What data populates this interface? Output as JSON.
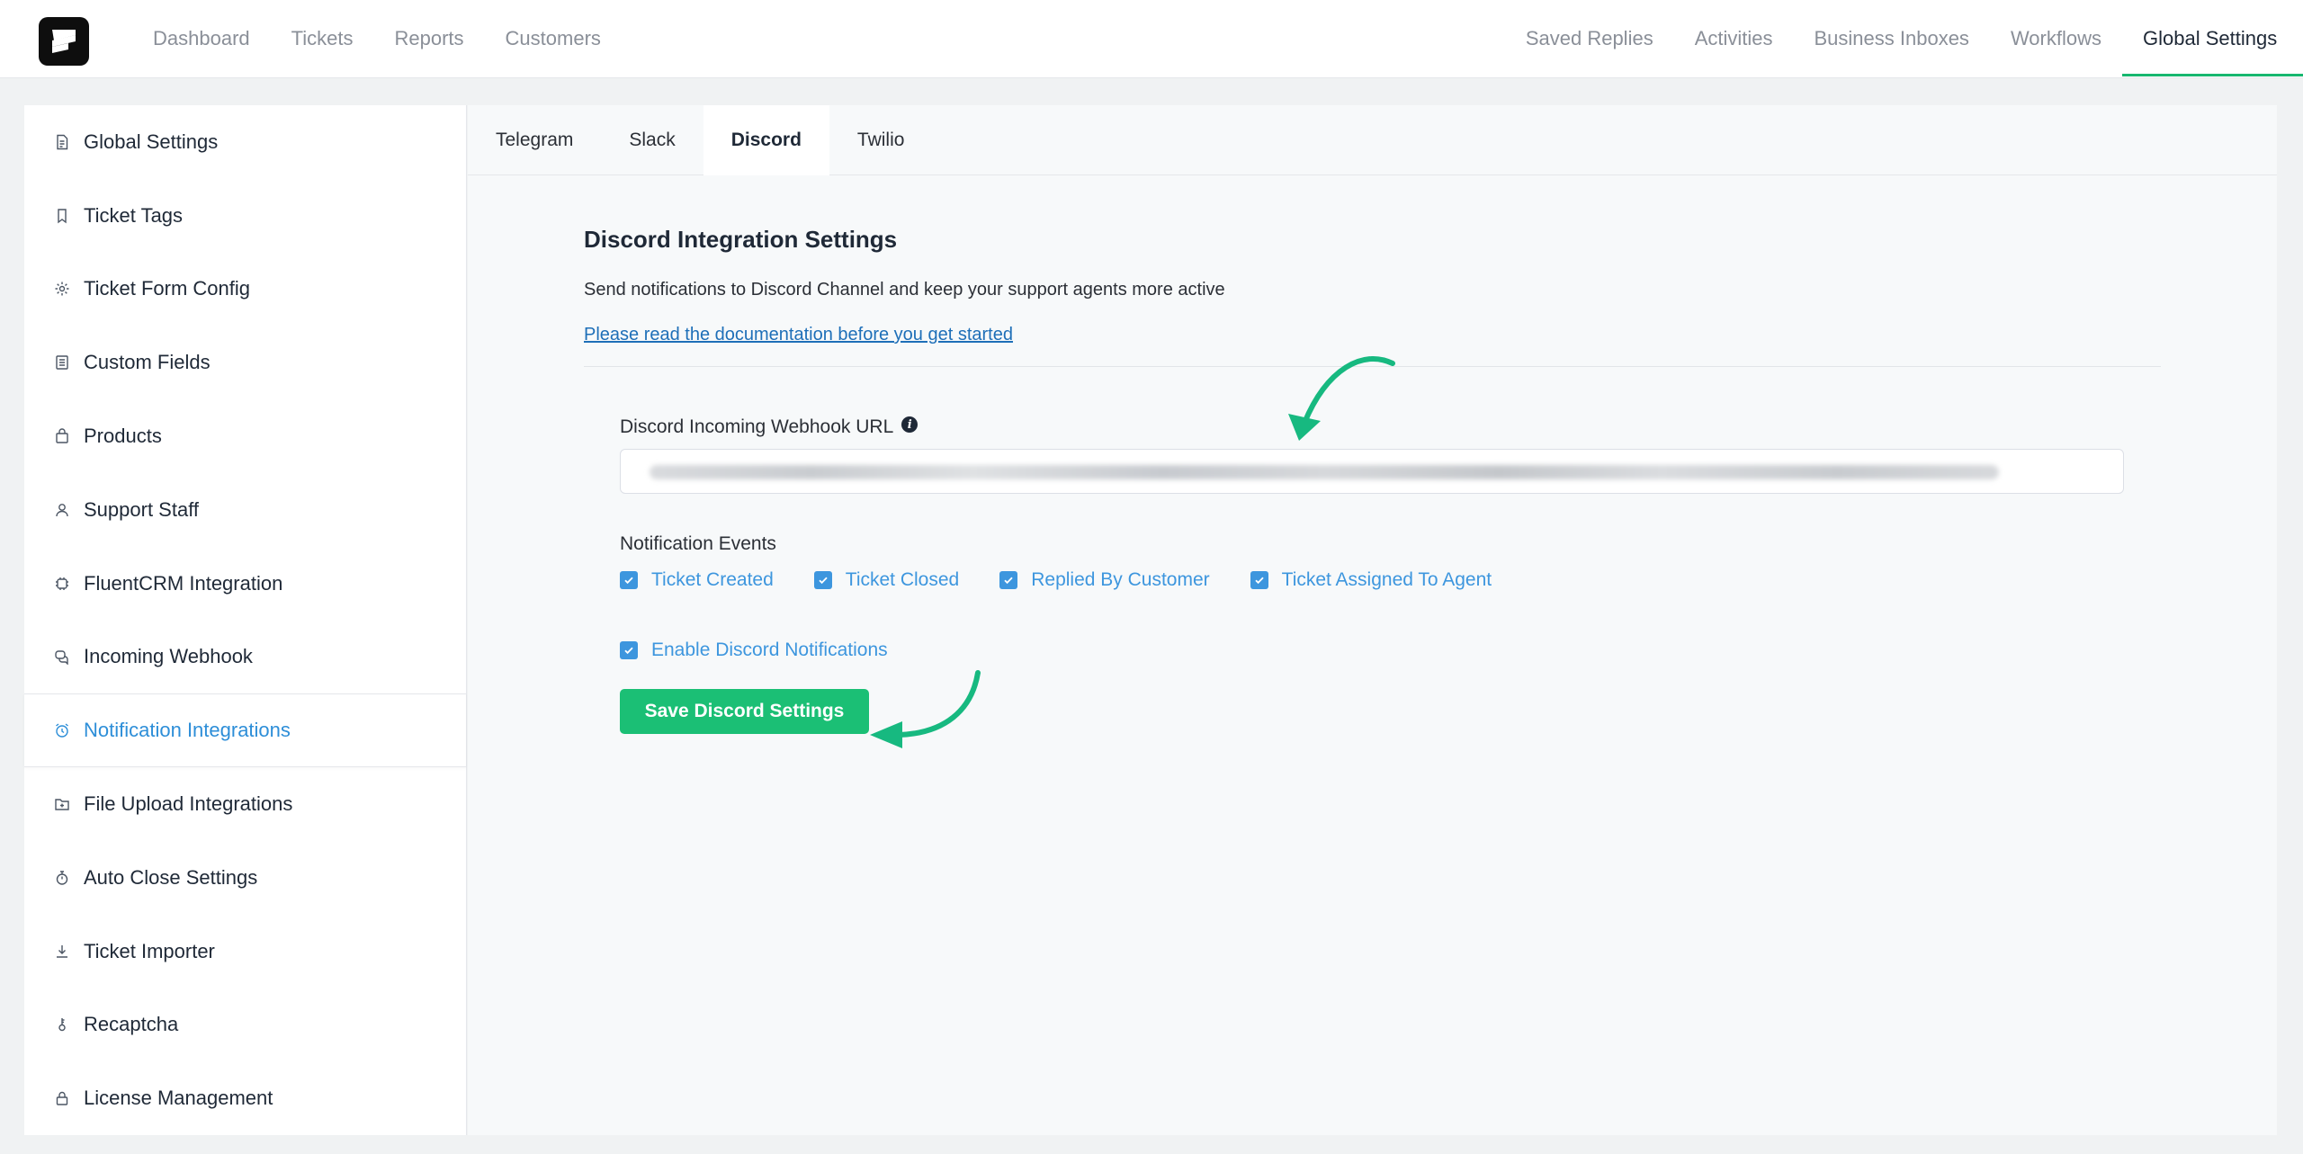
{
  "topnav": {
    "left": [
      "Dashboard",
      "Tickets",
      "Reports",
      "Customers"
    ],
    "right": [
      "Saved Replies",
      "Activities",
      "Business Inboxes",
      "Workflows",
      "Global Settings"
    ],
    "active": "Global Settings"
  },
  "sidebar": {
    "items": [
      {
        "label": "Global Settings",
        "icon": "document-icon"
      },
      {
        "label": "Ticket Tags",
        "icon": "bookmark-icon"
      },
      {
        "label": "Ticket Form Config",
        "icon": "gear-icon"
      },
      {
        "label": "Custom Fields",
        "icon": "list-icon"
      },
      {
        "label": "Products",
        "icon": "bag-icon"
      },
      {
        "label": "Support Staff",
        "icon": "user-icon"
      },
      {
        "label": "FluentCRM Integration",
        "icon": "chip-icon"
      },
      {
        "label": "Incoming Webhook",
        "icon": "chat-icon"
      },
      {
        "label": "Notification Integrations",
        "icon": "alarm-icon",
        "active": true
      },
      {
        "label": "File Upload Integrations",
        "icon": "folder-icon"
      },
      {
        "label": "Auto Close Settings",
        "icon": "stopwatch-icon"
      },
      {
        "label": "Ticket Importer",
        "icon": "download-icon"
      },
      {
        "label": "Recaptcha",
        "icon": "key-icon"
      },
      {
        "label": "License Management",
        "icon": "lock-icon"
      }
    ]
  },
  "tabs": [
    "Telegram",
    "Slack",
    "Discord",
    "Twilio"
  ],
  "active_tab": "Discord",
  "panel": {
    "title": "Discord Integration Settings",
    "description": "Send notifications to Discord Channel and keep your support agents more active",
    "doc_link": "Please read the documentation before you get started",
    "webhook_label": "Discord Incoming Webhook URL",
    "info_glyph": "i",
    "events_label": "Notification Events",
    "events": [
      "Ticket Created",
      "Ticket Closed",
      "Replied By Customer",
      "Ticket Assigned To Agent"
    ],
    "enable_label": "Enable Discord Notifications",
    "save_label": "Save Discord Settings"
  },
  "colors": {
    "accent": "#1bbf75",
    "link": "#1e6fb8",
    "checkbox": "#3d96de",
    "active_sidebar": "#2d8ed8",
    "annotation_arrow": "#17b980"
  }
}
